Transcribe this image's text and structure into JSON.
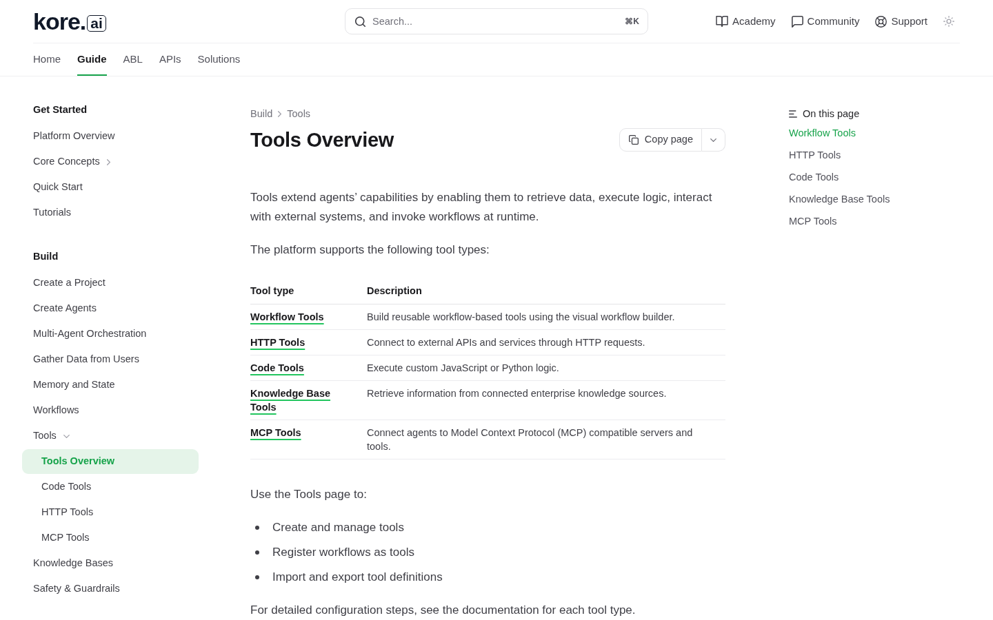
{
  "header": {
    "logo": {
      "brand": "kore",
      "separator": ".",
      "tld": "ai"
    },
    "search": {
      "placeholder": "Search...",
      "shortcut": "⌘K"
    },
    "links": [
      {
        "label": "Academy"
      },
      {
        "label": "Community"
      },
      {
        "label": "Support"
      }
    ]
  },
  "tabs": [
    {
      "label": "Home",
      "selected": false
    },
    {
      "label": "Guide",
      "selected": true
    },
    {
      "label": "ABL",
      "selected": false
    },
    {
      "label": "APIs",
      "selected": false
    },
    {
      "label": "Solutions",
      "selected": false
    }
  ],
  "sidebar": {
    "sections": [
      {
        "title": "Get Started",
        "items": [
          {
            "label": "Platform Overview",
            "selected": false
          },
          {
            "label": "Core Concepts",
            "selected": false,
            "expanded": false
          },
          {
            "label": "Quick Start",
            "selected": false
          },
          {
            "label": "Tutorials",
            "selected": false
          }
        ]
      },
      {
        "title": "Build",
        "items": [
          {
            "label": "Create a Project",
            "selected": false
          },
          {
            "label": "Create Agents",
            "selected": false
          },
          {
            "label": "Multi-Agent Orchestration",
            "selected": false
          },
          {
            "label": "Gather Data from Users",
            "selected": false
          },
          {
            "label": "Memory and State",
            "selected": false
          },
          {
            "label": "Workflows",
            "selected": false
          },
          {
            "label": "Tools",
            "selected": false,
            "expanded": true,
            "children": [
              {
                "label": "Tools Overview",
                "selected": true
              },
              {
                "label": "Code Tools",
                "selected": false
              },
              {
                "label": "HTTP Tools",
                "selected": false
              },
              {
                "label": "MCP Tools",
                "selected": false
              }
            ]
          },
          {
            "label": "Knowledge Bases",
            "selected": false
          },
          {
            "label": "Safety & Guardrails",
            "selected": false
          }
        ]
      }
    ]
  },
  "article": {
    "breadcrumb": [
      "Build",
      "Tools"
    ],
    "title": "Tools Overview",
    "copy_button": {
      "label": "Copy page"
    },
    "content": [
      {
        "kind": "paragraph",
        "text": "Tools extend agents’ capabilities by enabling them to retrieve data, execute logic, interact with external systems, and invoke workflows at runtime."
      },
      {
        "kind": "paragraph",
        "text": "The platform supports the following tool types:"
      },
      {
        "kind": "table",
        "columns": [
          "Tool type",
          "Description"
        ],
        "rows": [
          [
            "Workflow Tools",
            "Build reusable workflow-based tools using the visual workflow builder."
          ],
          [
            "HTTP Tools",
            "Connect to external APIs and services through HTTP requests."
          ],
          [
            "Code Tools",
            "Execute custom JavaScript or Python logic."
          ],
          [
            "Knowledge Base Tools",
            "Retrieve information from connected enterprise knowledge sources."
          ],
          [
            "MCP Tools",
            "Connect agents to Model Context Protocol (MCP) compatible servers and tools."
          ]
        ]
      },
      {
        "kind": "paragraph",
        "text": "Use the Tools page to:"
      },
      {
        "kind": "list",
        "items": [
          "Create and manage tools",
          "Register workflows as tools",
          "Import and export tool definitions"
        ]
      },
      {
        "kind": "paragraph",
        "text": "For detailed configuration steps, see the documentation for each tool type."
      }
    ]
  },
  "toc": {
    "title": "On this page",
    "items": [
      {
        "label": "Workflow Tools",
        "selected": true
      },
      {
        "label": "HTTP Tools",
        "selected": false
      },
      {
        "label": "Code Tools",
        "selected": false
      },
      {
        "label": "Knowledge Base Tools",
        "selected": false
      },
      {
        "label": "MCP Tools",
        "selected": false
      }
    ]
  }
}
